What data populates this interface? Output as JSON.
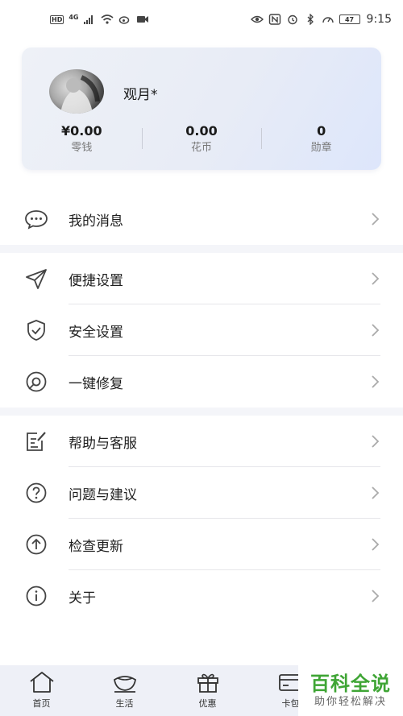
{
  "status_bar": {
    "left_badges": [
      "HD",
      "4G"
    ],
    "battery": "47",
    "time": "9:15"
  },
  "profile": {
    "name": "观月*",
    "stats": [
      {
        "value": "¥0.00",
        "label": "零钱"
      },
      {
        "value": "0.00",
        "label": "花币"
      },
      {
        "value": "0",
        "label": "勋章"
      }
    ]
  },
  "menu": {
    "group1": [
      {
        "label": "我的消息",
        "icon": "message-icon"
      }
    ],
    "group2": [
      {
        "label": "便捷设置",
        "icon": "send-icon"
      },
      {
        "label": "安全设置",
        "icon": "shield-icon"
      },
      {
        "label": "一键修复",
        "icon": "repair-icon"
      }
    ],
    "group3": [
      {
        "label": "帮助与客服",
        "icon": "edit-icon"
      },
      {
        "label": "问题与建议",
        "icon": "question-icon"
      },
      {
        "label": "检查更新",
        "icon": "upload-icon"
      },
      {
        "label": "关于",
        "icon": "info-icon"
      }
    ]
  },
  "tabbar": [
    {
      "label": "首页",
      "icon": "home-icon"
    },
    {
      "label": "生活",
      "icon": "cup-icon"
    },
    {
      "label": "优惠",
      "icon": "gift-icon"
    },
    {
      "label": "卡包",
      "icon": "card-icon"
    }
  ],
  "watermark": {
    "title": "百科全说",
    "subtitle": "助你轻松解决"
  }
}
